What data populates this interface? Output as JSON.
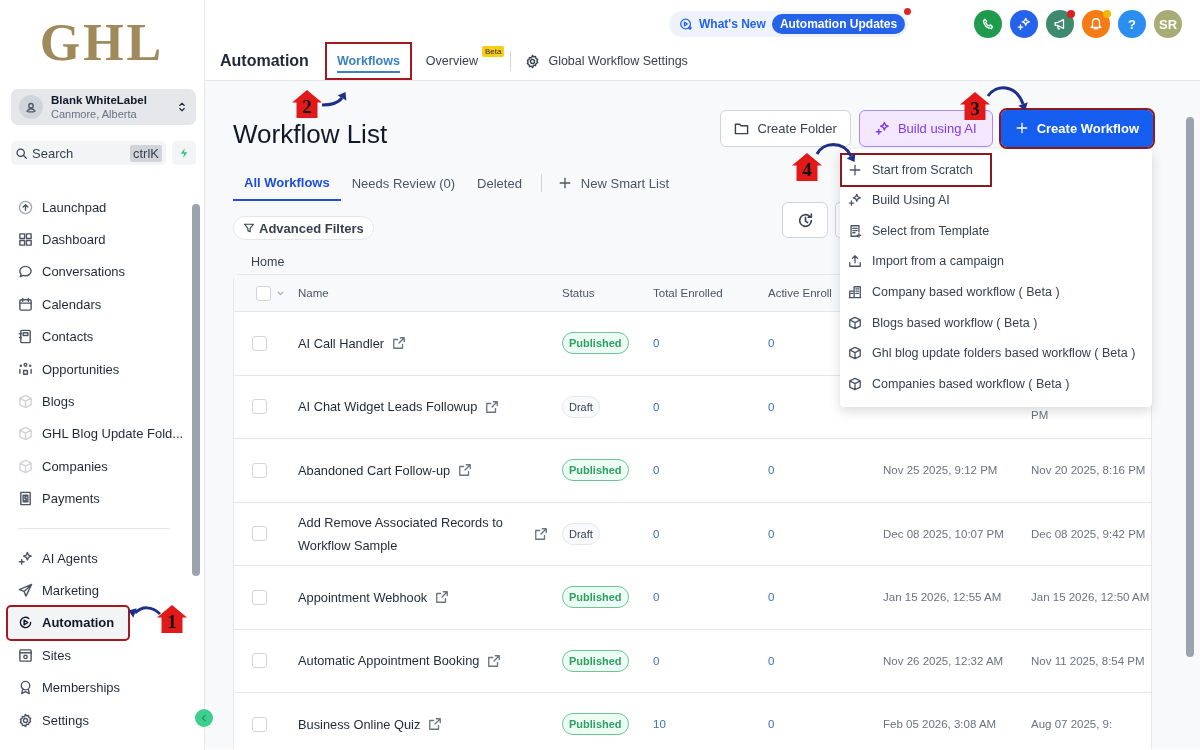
{
  "sidebar": {
    "logo": "GHL",
    "account": {
      "name": "Blank WhiteLabel",
      "location": "Canmore, Alberta"
    },
    "search": {
      "placeholder": "Search",
      "shortcut": "ctrlK"
    },
    "sections": [
      {
        "items": [
          {
            "label": "Launchpad",
            "selected": false,
            "annotated": false
          },
          {
            "label": "Dashboard",
            "selected": false,
            "annotated": false
          },
          {
            "label": "Conversations",
            "selected": false,
            "annotated": false
          },
          {
            "label": "Calendars",
            "selected": false,
            "annotated": false
          },
          {
            "label": "Contacts",
            "selected": false,
            "annotated": false
          },
          {
            "label": "Opportunities",
            "selected": false,
            "annotated": false
          },
          {
            "label": "Blogs",
            "selected": false,
            "annotated": false
          },
          {
            "label": "GHL Blog Update Fold...",
            "selected": false,
            "annotated": false
          },
          {
            "label": "Companies",
            "selected": false,
            "annotated": false
          },
          {
            "label": "Payments",
            "selected": false,
            "annotated": false
          }
        ]
      },
      {
        "items": [
          {
            "label": "AI Agents",
            "selected": false,
            "annotated": false
          },
          {
            "label": "Marketing",
            "selected": false,
            "annotated": false
          },
          {
            "label": "Automation",
            "selected": true,
            "annotated": true
          },
          {
            "label": "Sites",
            "selected": false,
            "annotated": false
          },
          {
            "label": "Memberships",
            "selected": false,
            "annotated": false
          },
          {
            "label": "Settings",
            "selected": false,
            "annotated": false
          }
        ]
      }
    ]
  },
  "header": {
    "whats_new": "What's New",
    "updates": "Automation Updates",
    "buttons": [
      {
        "kind": "phone",
        "color": "#1e9b4c"
      },
      {
        "kind": "sparkle",
        "color": "#2563eb"
      },
      {
        "kind": "megaphone",
        "color": "#3e8a6f",
        "dot": {
          "color": "#e11d1d"
        }
      },
      {
        "kind": "bell",
        "color": "#f47b16",
        "dot": {
          "color": "#f5b800"
        }
      },
      {
        "kind": "text",
        "color": "#2b8ef0",
        "label": "?"
      },
      {
        "kind": "text",
        "color": "#a8ad74",
        "label": "SR"
      }
    ],
    "title": "Automation",
    "tabs": [
      {
        "label": "Workflows",
        "selected": true,
        "annotated": true
      },
      {
        "label": "Overview",
        "selected": false,
        "annotated": false,
        "badge": "Beta"
      },
      {
        "label": "Global Workflow Settings",
        "selected": false,
        "annotated": false
      }
    ]
  },
  "page": {
    "title": "Workflow List",
    "buttons": [
      {
        "label": "Create Folder",
        "kind": "outline",
        "annotated": false
      },
      {
        "label": "Build using AI",
        "kind": "ai",
        "annotated": false
      },
      {
        "label": "Create Workflow",
        "kind": "primary",
        "annotated": true
      }
    ],
    "tabs": [
      {
        "label": "All Workflows",
        "selected": true
      },
      {
        "label": "Needs Review (0)",
        "selected": false
      },
      {
        "label": "Deleted",
        "selected": false
      }
    ],
    "new_list": "New Smart List",
    "filters": "Advanced Filters",
    "breadcrumb": "Home"
  },
  "table": {
    "select_all": {
      "checked": false
    },
    "columns": [
      "Name",
      "Status",
      "Total Enrolled",
      "Active Enroll"
    ],
    "rows": [
      {
        "checked": false,
        "name": "AI Call Handler",
        "status": {
          "label": "Published",
          "kind": "published"
        },
        "total": "0",
        "active": "0"
      },
      {
        "checked": false,
        "name": "AI Chat Widget Leads Followup",
        "status": {
          "label": "Draft",
          "kind": "draft"
        },
        "total": "0",
        "active": "0",
        "updated": "PM",
        "covered": true
      },
      {
        "checked": false,
        "name": "Abandoned Cart Follow-up",
        "status": {
          "label": "Published",
          "kind": "published"
        },
        "total": "0",
        "active": "0",
        "created": "Nov 25 2025, 9:12 PM",
        "updated": "Nov 20 2025, 8:16 PM"
      },
      {
        "checked": false,
        "name": "Add Remove Associated Records to Workflow Sample",
        "status": {
          "label": "Draft",
          "kind": "draft"
        },
        "total": "0",
        "active": "0",
        "created": "Dec 08 2025, 10:07 PM",
        "updated": "Dec 08 2025, 9:42 PM"
      },
      {
        "checked": false,
        "name": "Appointment Webhook",
        "status": {
          "label": "Published",
          "kind": "published"
        },
        "total": "0",
        "active": "0",
        "created": "Jan 15 2026, 12:55 AM",
        "updated": "Jan 15 2026, 12:50 AM"
      },
      {
        "checked": false,
        "name": "Automatic Appointment Booking",
        "status": {
          "label": "Published",
          "kind": "published"
        },
        "total": "0",
        "active": "0",
        "created": "Nov 26 2025, 12:32 AM",
        "updated": "Nov 11 2025, 8:54 PM"
      },
      {
        "checked": false,
        "name": "Business Online Quiz",
        "status": {
          "label": "Published",
          "kind": "published"
        },
        "total": "10",
        "active": "0",
        "created": "Feb 05 2026, 3:08 AM",
        "updated": "Aug 07 2025, 9:"
      }
    ]
  },
  "menu": {
    "items": [
      {
        "label": "Start from Scratch",
        "annotated": true
      },
      {
        "label": "Build Using AI",
        "annotated": false
      },
      {
        "label": "Select from Template",
        "annotated": false
      },
      {
        "label": "Import from a campaign",
        "annotated": false
      },
      {
        "label": "Company based workflow ( Beta )",
        "annotated": false
      },
      {
        "label": "Blogs based workflow ( Beta )",
        "annotated": false
      },
      {
        "label": "Ghl blog update folders based workflow ( Beta )",
        "annotated": false
      },
      {
        "label": "Companies based workflow ( Beta )",
        "annotated": false
      }
    ]
  },
  "annotations": [
    {
      "number": "1"
    },
    {
      "number": "2"
    },
    {
      "number": "3"
    },
    {
      "number": "4"
    }
  ]
}
